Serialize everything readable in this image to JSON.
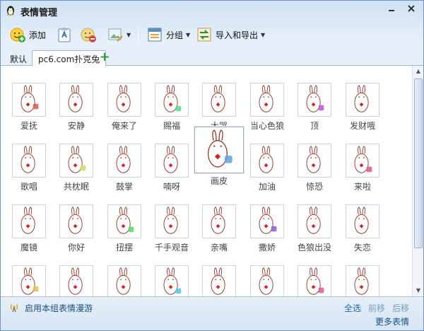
{
  "window": {
    "title": "表情管理",
    "minimize_icon": "minimize-icon",
    "close_icon": "close-icon"
  },
  "toolbar": {
    "add_label": "添加",
    "group_label": "分组",
    "import_export_label": "导入和导出"
  },
  "tabs": [
    {
      "label": "默认",
      "active": false
    },
    {
      "label": "pc6.com扑克兔",
      "active": true
    }
  ],
  "emoticons": [
    {
      "label": "爱抚"
    },
    {
      "label": "安静"
    },
    {
      "label": "俺来了"
    },
    {
      "label": "赐福"
    },
    {
      "label": "大哭"
    },
    {
      "label": "当心色狼"
    },
    {
      "label": "顶"
    },
    {
      "label": "发财哦"
    },
    {
      "label": "歌唱"
    },
    {
      "label": "共枕眠"
    },
    {
      "label": "鼓掌"
    },
    {
      "label": "喃呀"
    },
    {
      "label": "画皮"
    },
    {
      "label": "加油"
    },
    {
      "label": "惊恐"
    },
    {
      "label": "来啦"
    },
    {
      "label": "魔镜"
    },
    {
      "label": "你好"
    },
    {
      "label": "扭摆"
    },
    {
      "label": "千手观音"
    },
    {
      "label": "亲嘴"
    },
    {
      "label": "撒娇"
    },
    {
      "label": "色狼出没"
    },
    {
      "label": "失恋"
    },
    {
      "label": ""
    },
    {
      "label": ""
    },
    {
      "label": ""
    },
    {
      "label": ""
    },
    {
      "label": ""
    },
    {
      "label": ""
    },
    {
      "label": ""
    },
    {
      "label": ""
    }
  ],
  "status": {
    "roaming_text": "启用本组表情漫游",
    "select_all": "全选",
    "move_forward": "前移",
    "move_backward": "后移",
    "more_emoticons": "更多表情"
  }
}
